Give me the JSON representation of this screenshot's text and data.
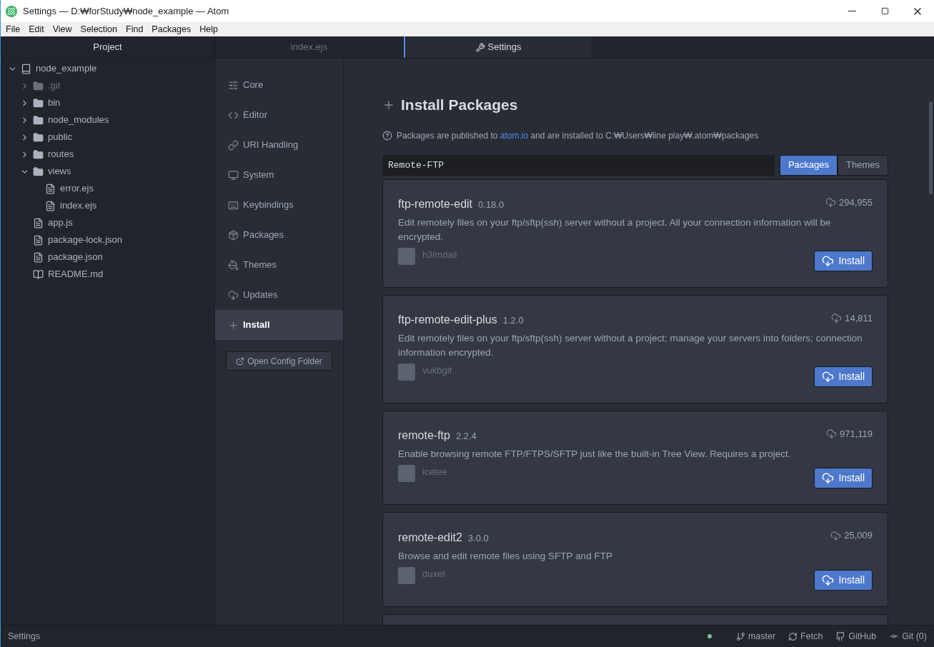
{
  "window": {
    "title": "Settings — D:₩forStudy₩node_example — Atom"
  },
  "menu": [
    "File",
    "Edit",
    "View",
    "Selection",
    "Find",
    "Packages",
    "Help"
  ],
  "tree": {
    "title": "Project",
    "root": {
      "name": "node_example",
      "kind": "repo",
      "expanded": true,
      "ignored": false,
      "children": [
        {
          "name": ".git",
          "kind": "folder",
          "expanded": false,
          "ignored": true
        },
        {
          "name": "bin",
          "kind": "folder",
          "expanded": false,
          "ignored": false
        },
        {
          "name": "node_modules",
          "kind": "folder",
          "expanded": false,
          "ignored": false
        },
        {
          "name": "public",
          "kind": "folder",
          "expanded": false,
          "ignored": false
        },
        {
          "name": "routes",
          "kind": "folder",
          "expanded": false,
          "ignored": false
        },
        {
          "name": "views",
          "kind": "folder",
          "expanded": true,
          "ignored": false,
          "children": [
            {
              "name": "error.ejs",
              "kind": "file",
              "ignored": false
            },
            {
              "name": "index.ejs",
              "kind": "file",
              "ignored": false
            }
          ]
        },
        {
          "name": "app.js",
          "kind": "file",
          "ignored": false
        },
        {
          "name": "package-lock.json",
          "kind": "file",
          "ignored": false
        },
        {
          "name": "package.json",
          "kind": "file",
          "ignored": false
        },
        {
          "name": "README.md",
          "kind": "readme",
          "ignored": false
        }
      ]
    }
  },
  "tabs": [
    {
      "label": "index.ejs",
      "kind": "file",
      "selected": false
    },
    {
      "label": "Settings",
      "kind": "settings",
      "selected": true
    }
  ],
  "settings_nav": {
    "items": [
      {
        "label": "Core",
        "kind": "core",
        "selected": false
      },
      {
        "label": "Editor",
        "kind": "editor",
        "selected": false
      },
      {
        "label": "URI Handling",
        "kind": "uri",
        "selected": false
      },
      {
        "label": "System",
        "kind": "system",
        "selected": false
      },
      {
        "label": "Keybindings",
        "kind": "keybindings",
        "selected": false
      },
      {
        "label": "Packages",
        "kind": "packages",
        "selected": false
      },
      {
        "label": "Themes",
        "kind": "themes",
        "selected": false
      },
      {
        "label": "Updates",
        "kind": "updates",
        "selected": false
      },
      {
        "label": "Install",
        "kind": "install",
        "selected": true
      }
    ],
    "button": "Open Config Folder"
  },
  "install": {
    "title": "Install Packages",
    "note_before": "Packages are published to ",
    "note_link": "atom.io",
    "note_after": " and are installed to C:₩Users₩line play₩.atom₩packages",
    "search_value": "Remote-FTP",
    "toggle": [
      {
        "label": "Packages",
        "selected": true
      },
      {
        "label": "Themes",
        "selected": false
      }
    ],
    "packages": [
      {
        "name": "ftp-remote-edit",
        "version": "0.18.0",
        "downloads": "294,955",
        "description": "Edit remotely files on your ftp/sftp(ssh) server without a project. All your connection information will be encrypted.",
        "author": "h3imdall",
        "button": "Install"
      },
      {
        "name": "ftp-remote-edit-plus",
        "version": "1.2.0",
        "downloads": "14,811",
        "description": "Edit remotely files on your ftp/sftp(ssh) server without a project; manage your servers into folders; connection information encrypted.",
        "author": "vukbgit",
        "button": "Install"
      },
      {
        "name": "remote-ftp",
        "version": "2.2.4",
        "downloads": "971,119",
        "description": "Enable browsing remote FTP/FTPS/SFTP just like the built-in Tree View. Requires a project.",
        "author": "icetee",
        "button": "Install"
      },
      {
        "name": "remote-edit2",
        "version": "3.0.0",
        "downloads": "25,009",
        "description": "Browse and edit remote files using SFTP and FTP",
        "author": "duxet",
        "button": "Install"
      }
    ]
  },
  "status_bar": {
    "left": "Settings",
    "branch": "master",
    "fetch": "Fetch",
    "github": "GitHub",
    "git": "Git (0)"
  }
}
